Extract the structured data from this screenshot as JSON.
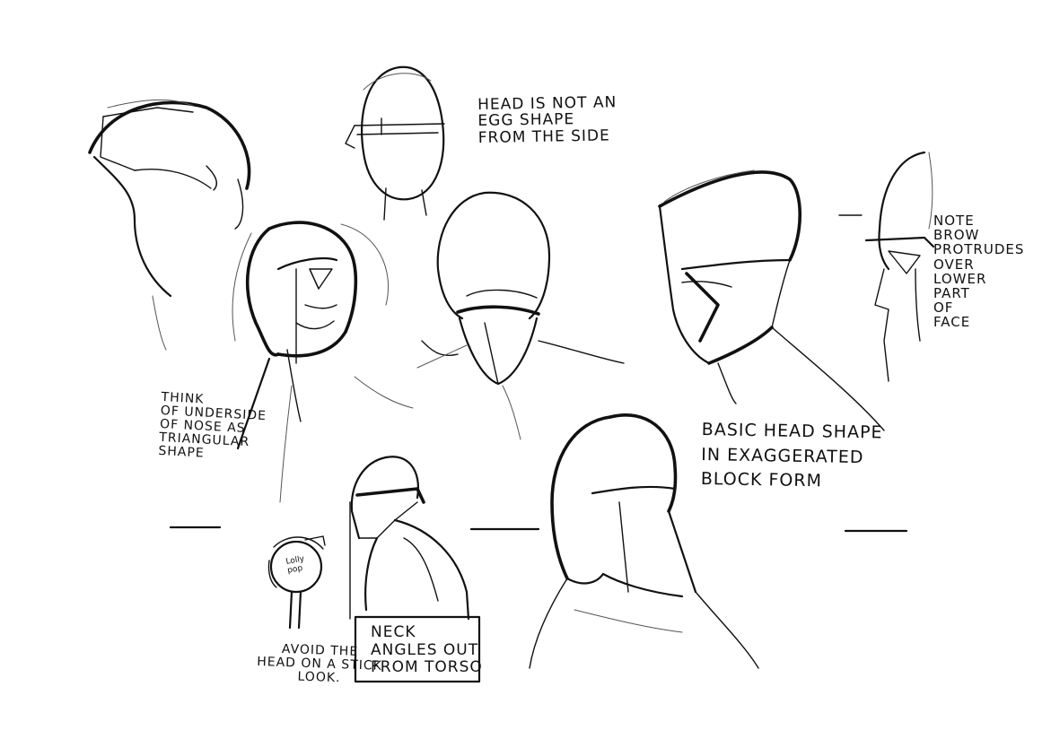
{
  "sheet": {
    "notes": {
      "egg_shape": "Head is not an\negg shape\nfrom the side",
      "brow": "Note\nbrow\nprotrudes\nover\nlower\npart\nof\nface",
      "nose": "Think\nof underside\nof nose as\ntriangular\nshape",
      "block": "Basic head shape\nin exaggerated\nblock form",
      "lollipop": "Avoid the\nhead on a stick\nlook.",
      "neck": "Neck\nangles out\nfrom torso",
      "lolly_label": "Lolly\npop"
    },
    "figures": [
      "head-tilted-up-sketch",
      "egg-side-head-sketch",
      "nose-underside-head-sketch",
      "head-looking-down-sketch",
      "block-form-head-sketch",
      "brow-profile-sketch",
      "lollipop-head-sketch",
      "neck-profile-sketch",
      "back-of-head-sketch"
    ]
  }
}
